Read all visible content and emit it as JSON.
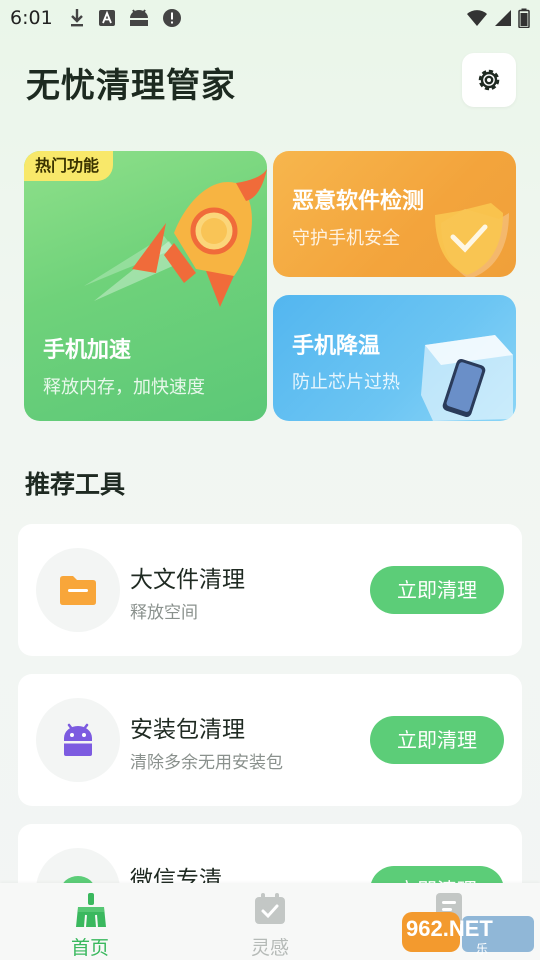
{
  "status_bar": {
    "time": "6:01",
    "left_icons": [
      "download-icon",
      "font-a-icon",
      "android-icon",
      "alert-icon"
    ],
    "right_icons": [
      "wifi-icon",
      "signal-icon",
      "battery-icon"
    ]
  },
  "header": {
    "title": "无忧清理管家",
    "settings_icon": "gear-icon"
  },
  "features": {
    "speed": {
      "badge": "热门功能",
      "title": "手机加速",
      "subtitle": "释放内存，加快速度"
    },
    "malware": {
      "title": "恶意软件检测",
      "subtitle": "守护手机安全"
    },
    "cool": {
      "title": "手机降温",
      "subtitle": "防止芯片过热"
    }
  },
  "tools_section": {
    "title": "推荐工具",
    "items": [
      {
        "name": "大文件清理",
        "desc": "释放空间",
        "button": "立即清理",
        "icon": "folder-icon",
        "icon_color": "#f8a63a"
      },
      {
        "name": "安装包清理",
        "desc": "清除多余无用安装包",
        "button": "立即清理",
        "icon": "android-icon",
        "icon_color": "#7c5be0"
      },
      {
        "name": "微信专清",
        "desc": "",
        "button": "立即清理",
        "icon": "wechat-icon",
        "icon_color": "#5ccd78"
      }
    ]
  },
  "bottom_nav": {
    "items": [
      {
        "label": "首页",
        "icon": "broom-icon",
        "active": true
      },
      {
        "label": "灵感",
        "icon": "calendar-check-icon",
        "active": false
      },
      {
        "label": "",
        "icon": "document-icon",
        "active": false
      }
    ]
  },
  "watermark": {
    "text": "962.NET",
    "sub": "乐游网"
  },
  "colors": {
    "accent": "#5ccd78",
    "active_nav": "#3ab85e",
    "inactive_nav": "#b5bab7"
  }
}
